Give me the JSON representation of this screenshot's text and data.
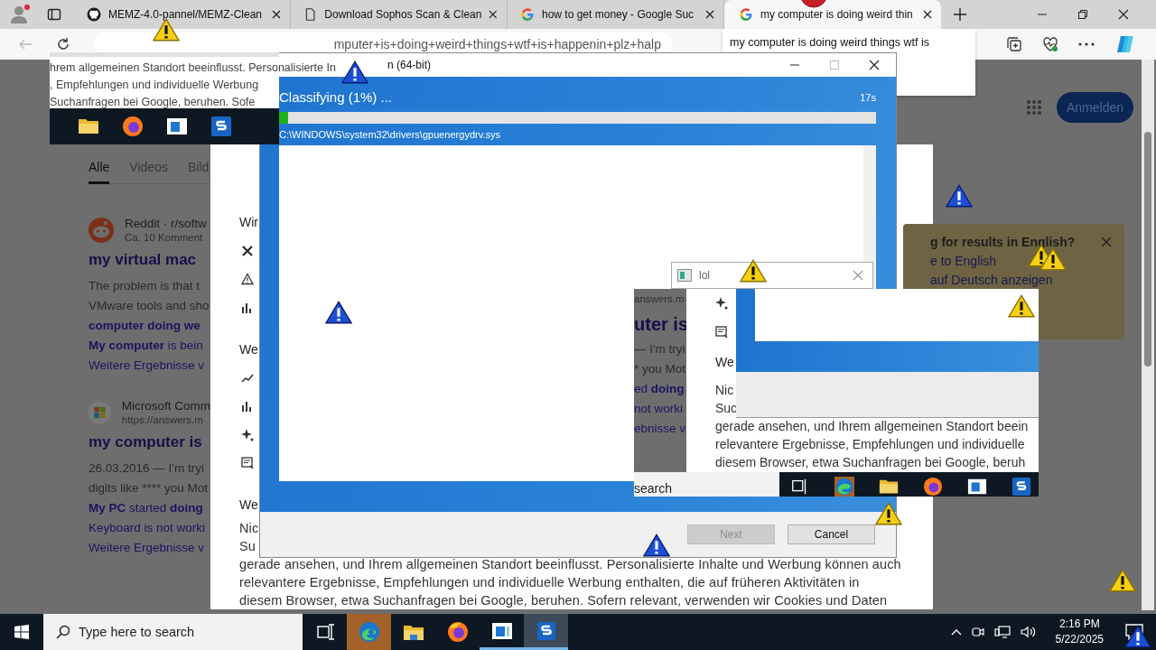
{
  "browser": {
    "tabs": [
      {
        "kind": "github",
        "label": "MEMZ-4.0-pannel/MEMZ-Clean",
        "selected": false
      },
      {
        "kind": "page",
        "label": "Download Sophos Scan & Clean",
        "selected": false
      },
      {
        "kind": "google",
        "label": "how to get money - Google Suc",
        "selected": false
      },
      {
        "kind": "google",
        "label": "my computer is doing weird thin",
        "selected": true
      }
    ],
    "address": "mputer+is+doing+weird+things+wtf+is+happenin+plz+halp",
    "suggestion": "my computer is doing weird things wtf is"
  },
  "search_page": {
    "tabs": [
      {
        "label": "Alle",
        "selected": true
      },
      {
        "label": "Videos",
        "selected": false
      },
      {
        "label": "Bild",
        "selected": false
      }
    ],
    "results": [
      {
        "kind": "reddit",
        "source": "Reddit · r/softw",
        "meta": "Ca. 10 Komment",
        "title": "my virtual mac",
        "snippet": [
          "The problem is that t",
          "VMware tools and sho"
        ],
        "links": [
          "**computer doing we**",
          "**My computer** is bein",
          "Weitere Ergebnisse v"
        ]
      },
      {
        "kind": "microsoft",
        "source": "Microsoft Comm",
        "meta": "https://answers.m",
        "title": "my computer is",
        "snippet": [
          "26.03.2016 — I'm tryi",
          "digits like **** you Mot"
        ],
        "links": [
          "**My PC** started **doing**",
          "Keyboard is not worki",
          "Weitere Ergebnisse v"
        ]
      }
    ],
    "sign_in": "Anmelden",
    "panel": {
      "items": [
        {
          "kind": "heading",
          "text": "Wir"
        },
        {
          "kind": "tools"
        },
        {
          "kind": "alert"
        },
        {
          "kind": "chart"
        },
        {
          "kind": "heading",
          "text": "We"
        },
        {
          "kind": "trend"
        },
        {
          "kind": "chart"
        },
        {
          "kind": "sparkle"
        },
        {
          "kind": "news"
        },
        {
          "kind": "heading",
          "text": "We"
        }
      ],
      "paragraph": [
        "Nic",
        "Su",
        "gerade ansehen, und Ihrem allgemeinen Standort beeinflusst. Personalisierte Inhalte und Werbung können auch",
        "relevantere Ergebnisse, Empfehlungen und individuelle Werbung enthalten, die auf früheren Aktivitäten in",
        "diesem Browser, etwa Suchanfragen bei Google, beruhen. Sofern relevant, verwenden wir Cookies und Daten"
      ]
    },
    "language_card": {
      "title": "g for results in English?",
      "links": [
        "e to English",
        "auf Deutsch anzeigen"
      ]
    }
  },
  "sophos": {
    "title": "n (64-bit)",
    "status": "Classifying (1%) ...",
    "time": "17s",
    "level": 0.015,
    "path": "C:\\WINDOWS\\system32\\drivers\\gpuenergydrv.sys",
    "buttons": [
      {
        "label": "Next",
        "disabled": true
      },
      {
        "label": "Cancel",
        "disabled": false
      }
    ]
  },
  "glitch_top": {
    "lines": [
      "hrem allgemeinen Standort beeinflusst. Personalisierte In",
      ", Empfehlungen und individuelle Werbung",
      "Suchanfragen bei Google, beruhen. Sofe"
    ]
  },
  "glitch_mid": {
    "left_lines": [
      {
        "kind": "meta",
        "text": "answers.m"
      },
      {
        "kind": "title",
        "text": "uter is"
      },
      {
        "kind": "text",
        "text": "— I'm tryi"
      },
      {
        "kind": "text",
        "text": "* you Mot"
      },
      {
        "kind": "link",
        "text": "ed **doing**"
      },
      {
        "kind": "link",
        "text": "not worki"
      },
      {
        "kind": "link",
        "text": "ebnisse v"
      }
    ],
    "heading": "We",
    "paragraph": [
      "Nic",
      "Suc",
      "gerade ansehen, und Ihrem allgemeinen Standort beein",
      "relevantere Ergebnisse, Empfehlungen und individuelle",
      "diesem Browser, etwa Suchanfragen bei Google, beruh"
    ],
    "search": "search"
  },
  "lol_window": {
    "title": "lol"
  },
  "taskbar": {
    "placeholder": "Type here to search",
    "apps": [
      {
        "kind": "taskview",
        "flashing": false,
        "focused": false,
        "running": false
      },
      {
        "kind": "edge",
        "flashing": true,
        "focused": false,
        "running": false
      },
      {
        "kind": "folder",
        "flashing": false,
        "focused": false,
        "running": false
      },
      {
        "kind": "firefox",
        "flashing": false,
        "focused": false,
        "running": false
      },
      {
        "kind": "app",
        "flashing": false,
        "focused": false,
        "running": true
      },
      {
        "kind": "sophos",
        "flashing": false,
        "focused": true,
        "running": true
      }
    ],
    "time": "2:16 PM",
    "date": "5/22/2025"
  }
}
